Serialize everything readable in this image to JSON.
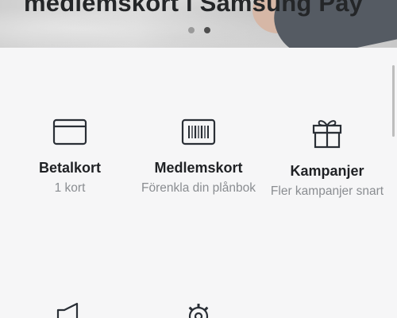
{
  "banner": {
    "title": "medlemskort i Samsung Pay",
    "carousel_dots": 2,
    "active_dot": 1
  },
  "tiles": [
    {
      "title": "Betalkort",
      "subtitle": "1 kort",
      "icon": "credit-card-icon"
    },
    {
      "title": "Medlemskort",
      "subtitle": "Förenkla din plånbok",
      "icon": "barcode-card-icon"
    },
    {
      "title": "Kampanjer",
      "subtitle": "Fler kampanjer snart",
      "icon": "gift-icon"
    }
  ],
  "partial_tiles": [
    {
      "icon": "megaphone-icon"
    },
    {
      "icon": "gear-icon"
    }
  ],
  "colors": {
    "background": "#f6f6f7",
    "icon_stroke": "#2a2f36",
    "title_text": "#1f2124",
    "subtitle_text": "#8a8d91"
  }
}
